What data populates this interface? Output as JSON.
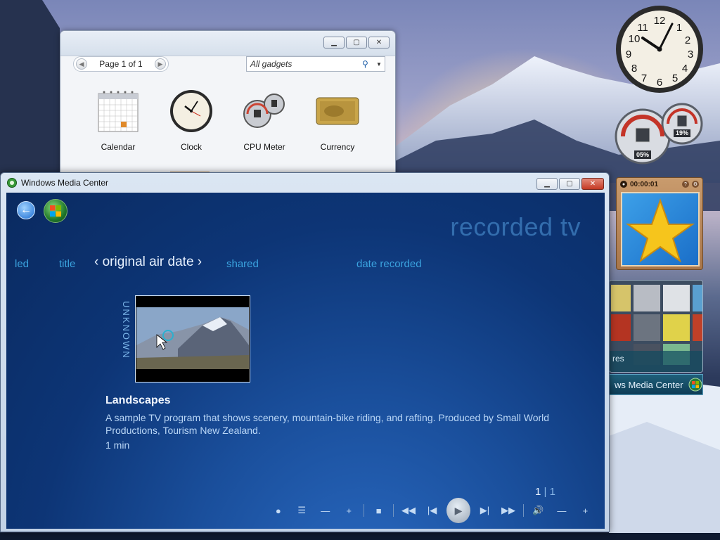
{
  "gadget_gallery": {
    "pager_text": "Page 1 of 1",
    "search_placeholder": "All gadgets",
    "gadgets": [
      {
        "name": "Calendar",
        "icon": "calendar-icon"
      },
      {
        "name": "Clock",
        "icon": "clock-icon"
      },
      {
        "name": "CPU Meter",
        "icon": "cpu-meter-icon"
      },
      {
        "name": "Currency",
        "icon": "currency-icon"
      }
    ]
  },
  "clock_gadget": {
    "hour": 10,
    "minute": 10
  },
  "cpu_gadget": {
    "cpu_label": "05%",
    "memory_label": "19%"
  },
  "slideshow_gadget": {
    "timer": "00:00:01",
    "icon": "star-icon"
  },
  "taskbar_strip": {
    "label": "ws Media Center",
    "partial_text": "res"
  },
  "media_center": {
    "window_title": "Windows Media Center",
    "heading": "recorded tv",
    "tabs": [
      {
        "label": "led",
        "active": false
      },
      {
        "label": "title",
        "active": false
      },
      {
        "label": "original air date",
        "active": true
      },
      {
        "label": "shared",
        "active": false
      },
      {
        "label": "date recorded",
        "active": false
      }
    ],
    "group_label": "UNKNOWN",
    "selected_show": {
      "title": "Landscapes",
      "description": "A sample TV program that shows scenery, mountain-bike riding, and rafting. Produced by Small World Productions, Tourism New Zealand.",
      "duration": "1 min"
    },
    "page_current": "1",
    "page_separator": "|",
    "page_total": "1",
    "controls": [
      {
        "name": "record-button",
        "glyph": "●"
      },
      {
        "name": "list-button",
        "glyph": "☰"
      },
      {
        "name": "channel-down-button",
        "glyph": "—"
      },
      {
        "name": "channel-up-button",
        "glyph": "+"
      },
      {
        "name": "stop-button",
        "glyph": "■"
      },
      {
        "name": "rewind-button",
        "glyph": "◀◀"
      },
      {
        "name": "skip-back-button",
        "glyph": "|◀"
      },
      {
        "name": "play-button",
        "glyph": "▶"
      },
      {
        "name": "skip-forward-button",
        "glyph": "▶|"
      },
      {
        "name": "fast-forward-button",
        "glyph": "▶▶"
      },
      {
        "name": "mute-button",
        "glyph": "🔊"
      },
      {
        "name": "volume-down-button",
        "glyph": "—"
      },
      {
        "name": "volume-up-button",
        "glyph": "+"
      }
    ]
  },
  "colors": {
    "accent": "#3ba4e0",
    "mc_background": "#0d3576"
  }
}
